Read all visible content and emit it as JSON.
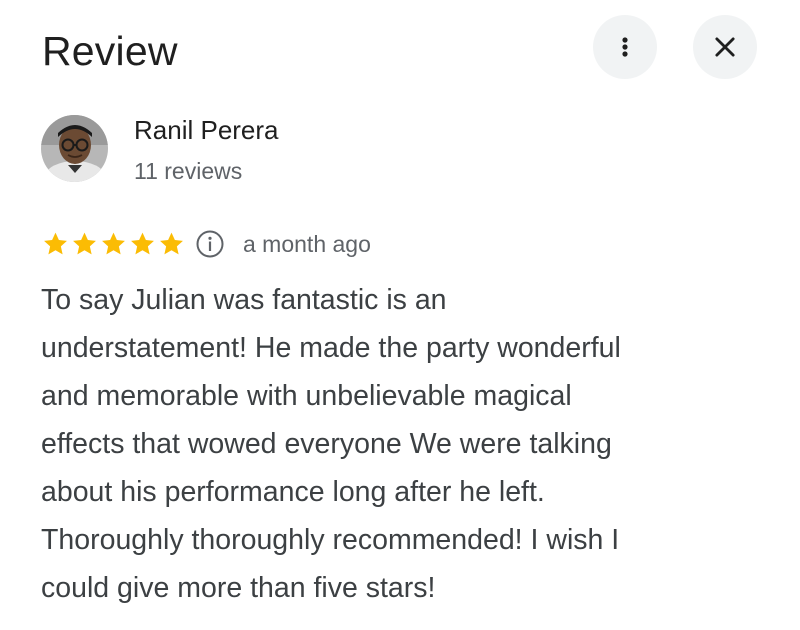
{
  "header": {
    "title": "Review",
    "more_icon": "more-vert-icon",
    "close_icon": "close-icon"
  },
  "author": {
    "name": "Ranil Perera",
    "reviews_count": "11 reviews"
  },
  "review": {
    "rating": 5,
    "rating_max": 5,
    "info_icon": "info-icon",
    "time_ago": "a month ago",
    "text": "To say Julian was fantastic is an\nunderstatement! He made the party wonderful\nand memorable with unbelievable magical\neffects that wowed everyone   We were talking\nabout his performance long after he left.\nThoroughly thoroughly recommended! I wish I\ncould give more than five stars!"
  },
  "colors": {
    "star": "#fbbc04",
    "button_bg": "#f1f3f4",
    "secondary_text": "#5f6368",
    "primary_text": "#1f1f1f"
  }
}
